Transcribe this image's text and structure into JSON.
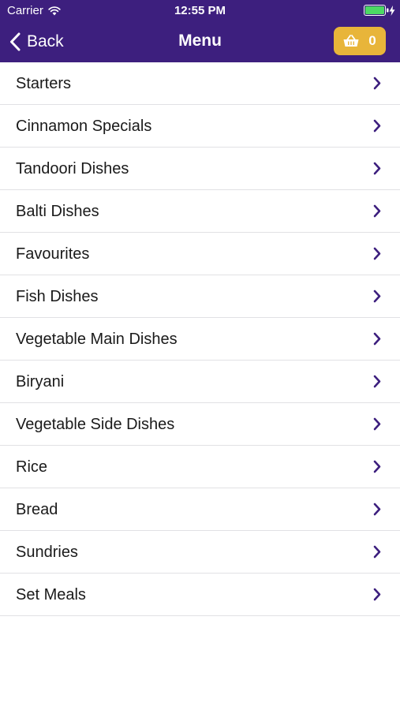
{
  "status_bar": {
    "carrier": "Carrier",
    "time": "12:55 PM",
    "icons": [
      "wifi-icon",
      "battery-icon",
      "charging-bolt-icon"
    ]
  },
  "nav": {
    "back_label": "Back",
    "title": "Menu",
    "basket_count": "0",
    "icons": [
      "chevron-left-icon",
      "basket-icon"
    ]
  },
  "menu": {
    "items": [
      {
        "label": "Starters"
      },
      {
        "label": "Cinnamon Specials"
      },
      {
        "label": "Tandoori Dishes"
      },
      {
        "label": "Balti Dishes"
      },
      {
        "label": "Favourites"
      },
      {
        "label": "Fish Dishes"
      },
      {
        "label": "Vegetable Main Dishes"
      },
      {
        "label": "Biryani"
      },
      {
        "label": "Vegetable Side Dishes"
      },
      {
        "label": "Rice"
      },
      {
        "label": "Bread"
      },
      {
        "label": "Sundries"
      },
      {
        "label": "Set Meals"
      }
    ],
    "item_icon": "chevron-right-icon"
  },
  "colors": {
    "header_background": "#3d1f7e",
    "basket_button": "#e8b53a",
    "battery_fill": "#4cd964",
    "chevron": "#3d1f7e",
    "divider": "#e1e1e4"
  }
}
